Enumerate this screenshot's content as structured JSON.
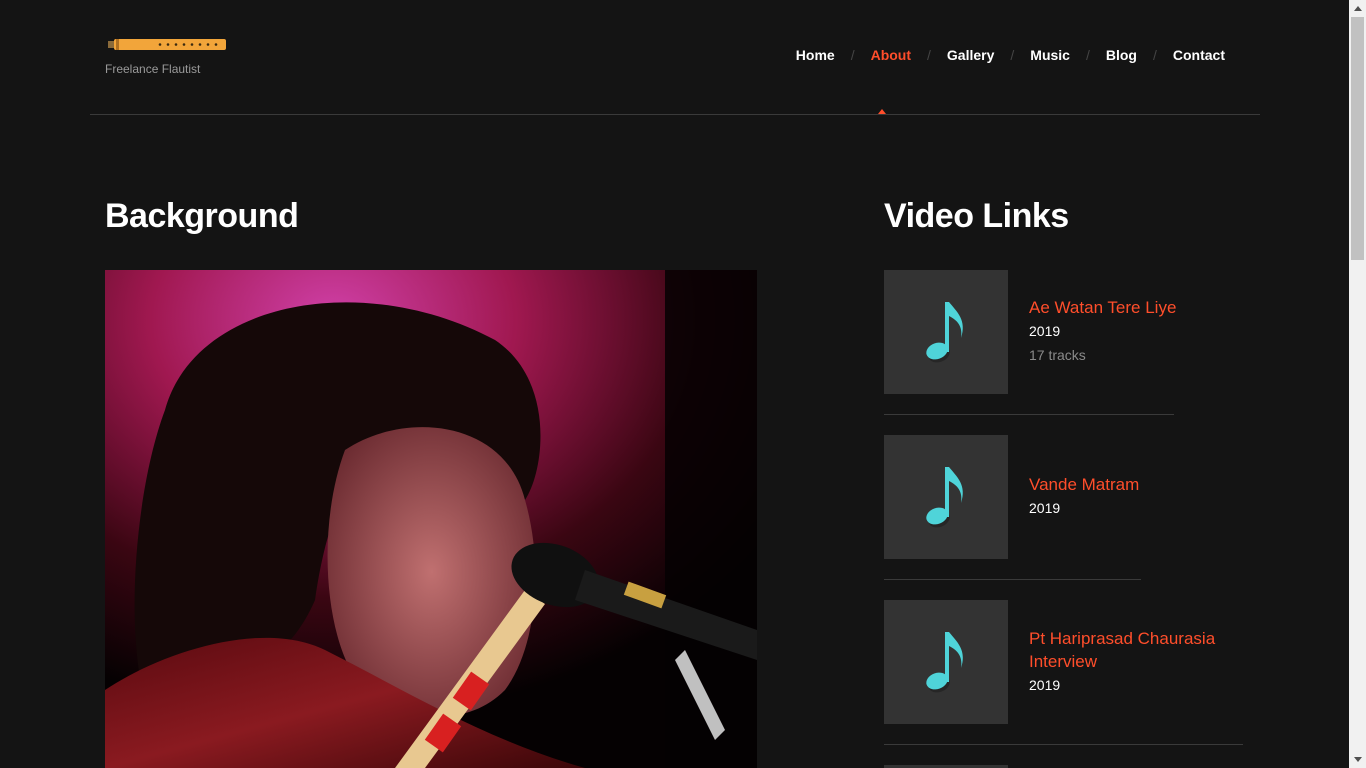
{
  "header": {
    "tagline": "Freelance Flautist",
    "nav": [
      {
        "label": "Home",
        "active": false
      },
      {
        "label": "About",
        "active": true
      },
      {
        "label": "Gallery",
        "active": false
      },
      {
        "label": "Music",
        "active": false
      },
      {
        "label": "Blog",
        "active": false
      },
      {
        "label": "Contact",
        "active": false
      }
    ],
    "separator": "/"
  },
  "main": {
    "background_title": "Background",
    "video_links_title": "Video Links",
    "videos": [
      {
        "title": "Ae Watan Tere Liye",
        "year": "2019",
        "tracks": "17 tracks"
      },
      {
        "title": "Vande Matram",
        "year": "2019"
      },
      {
        "title": "Pt Hariprasad Chaurasia Interview",
        "year": "2019"
      }
    ]
  },
  "colors": {
    "background": "#141414",
    "accent": "#ff4e2b",
    "thumb": "#333333",
    "note": "#4fd4d9",
    "logo": "#f2a53a"
  },
  "icons": [
    "flute-logo-icon",
    "music-note-icon",
    "scroll-up-icon",
    "scroll-down-icon"
  ]
}
